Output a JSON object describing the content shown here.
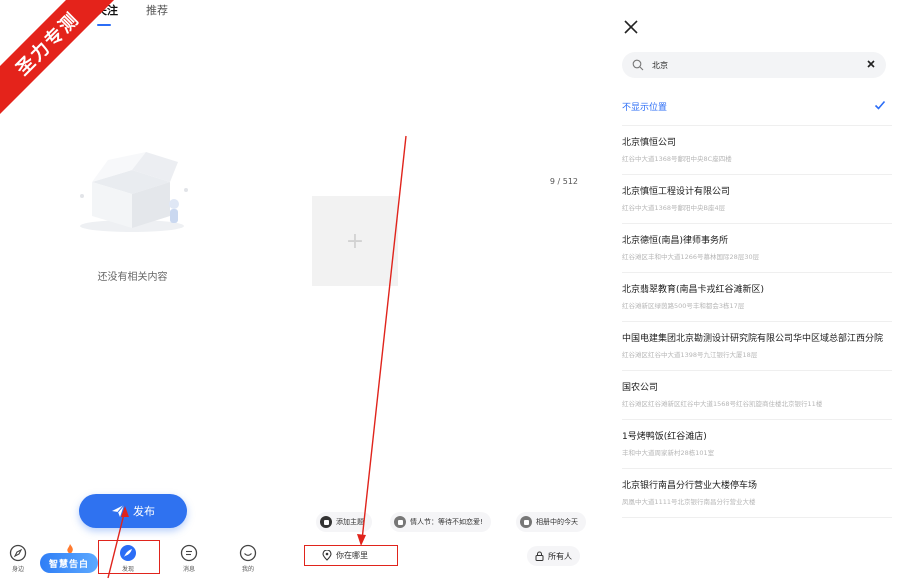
{
  "ribbon": {
    "text": "圣力专测"
  },
  "feed": {
    "tabs": [
      {
        "label": "关注"
      },
      {
        "label": "推荐"
      }
    ],
    "empty_text": "还没有相关内容",
    "publish_label": "发布",
    "badge_label": "智慧告白",
    "nav": [
      {
        "label": "身边",
        "icon": "compass-icon"
      },
      {
        "label": "",
        "icon": "badge-icon"
      },
      {
        "label": "发现",
        "icon": "feather-icon"
      },
      {
        "label": "消息",
        "icon": "message-icon"
      },
      {
        "label": "我的",
        "icon": "smile-icon"
      }
    ]
  },
  "compose": {
    "counter": "9 / 512",
    "add_symbol": "+",
    "chips": [
      {
        "label": "添加主题"
      },
      {
        "label": "情人节：等待不如恋爱!"
      },
      {
        "label": "相册中的今天"
      }
    ],
    "location_label": "你在哪里",
    "audience_label": "所有人"
  },
  "location_picker": {
    "search_value": "北京",
    "no_location_label": "不显示位置",
    "items": [
      {
        "name": "北京慎恒公司",
        "address": "红谷中大道1368号鄱阳中央8C座四楼"
      },
      {
        "name": "北京慎恒工程设计有限公司",
        "address": "红谷中大道1368号鄱阳中央B座4层"
      },
      {
        "name": "北京德恒(南昌)律师事务所",
        "address": "红谷滩区丰和中大道1266号慕林国际28层30层"
      },
      {
        "name": "北京翡翠教育(南昌卡戎红谷滩新区)",
        "address": "红谷滩新区绿茵路500号丰和都会3栋17层"
      },
      {
        "name": "中国电建集团北京勘测设计研究院有限公司华中区域总部江西分院",
        "address": "红谷滩区红谷中大道1398号九江银行大厦18层"
      },
      {
        "name": "国农公司",
        "address": "红谷滩区红谷滩新区红谷中大道1568号红谷凯旋商住楼北京银行11楼"
      },
      {
        "name": "1号烤鸭饭(红谷滩店)",
        "address": "丰和中大道周家新村28栋101室"
      },
      {
        "name": "北京银行南昌分行营业大楼停车场",
        "address": "凤凰中大道1111号北京银行南昌分行营业大楼"
      }
    ]
  },
  "colors": {
    "accent": "#2b6df6",
    "annotation": "#e0241c"
  }
}
